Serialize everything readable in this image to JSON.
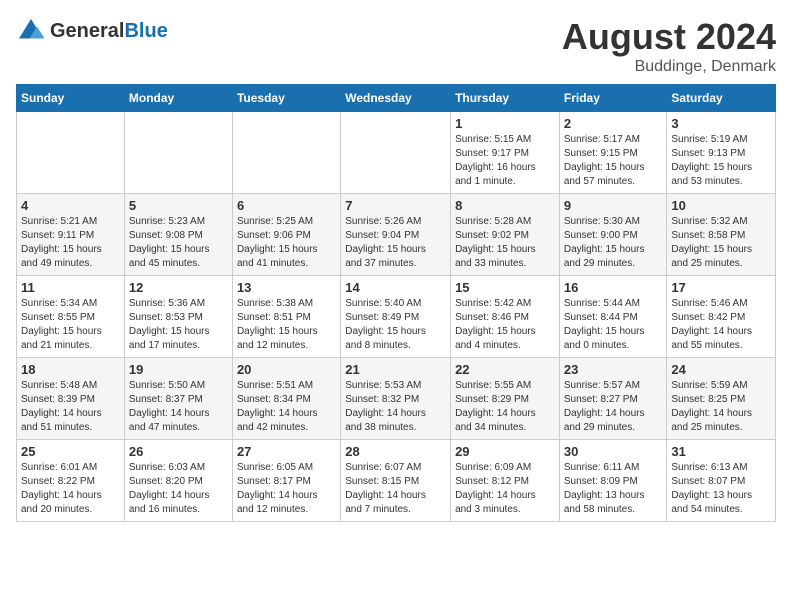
{
  "header": {
    "logo_general": "General",
    "logo_blue": "Blue",
    "title": "August 2024",
    "subtitle": "Buddinge, Denmark"
  },
  "calendar": {
    "days_of_week": [
      "Sunday",
      "Monday",
      "Tuesday",
      "Wednesday",
      "Thursday",
      "Friday",
      "Saturday"
    ],
    "weeks": [
      [
        {
          "day": "",
          "info": ""
        },
        {
          "day": "",
          "info": ""
        },
        {
          "day": "",
          "info": ""
        },
        {
          "day": "",
          "info": ""
        },
        {
          "day": "1",
          "info": "Sunrise: 5:15 AM\nSunset: 9:17 PM\nDaylight: 16 hours\nand 1 minute."
        },
        {
          "day": "2",
          "info": "Sunrise: 5:17 AM\nSunset: 9:15 PM\nDaylight: 15 hours\nand 57 minutes."
        },
        {
          "day": "3",
          "info": "Sunrise: 5:19 AM\nSunset: 9:13 PM\nDaylight: 15 hours\nand 53 minutes."
        }
      ],
      [
        {
          "day": "4",
          "info": "Sunrise: 5:21 AM\nSunset: 9:11 PM\nDaylight: 15 hours\nand 49 minutes."
        },
        {
          "day": "5",
          "info": "Sunrise: 5:23 AM\nSunset: 9:08 PM\nDaylight: 15 hours\nand 45 minutes."
        },
        {
          "day": "6",
          "info": "Sunrise: 5:25 AM\nSunset: 9:06 PM\nDaylight: 15 hours\nand 41 minutes."
        },
        {
          "day": "7",
          "info": "Sunrise: 5:26 AM\nSunset: 9:04 PM\nDaylight: 15 hours\nand 37 minutes."
        },
        {
          "day": "8",
          "info": "Sunrise: 5:28 AM\nSunset: 9:02 PM\nDaylight: 15 hours\nand 33 minutes."
        },
        {
          "day": "9",
          "info": "Sunrise: 5:30 AM\nSunset: 9:00 PM\nDaylight: 15 hours\nand 29 minutes."
        },
        {
          "day": "10",
          "info": "Sunrise: 5:32 AM\nSunset: 8:58 PM\nDaylight: 15 hours\nand 25 minutes."
        }
      ],
      [
        {
          "day": "11",
          "info": "Sunrise: 5:34 AM\nSunset: 8:55 PM\nDaylight: 15 hours\nand 21 minutes."
        },
        {
          "day": "12",
          "info": "Sunrise: 5:36 AM\nSunset: 8:53 PM\nDaylight: 15 hours\nand 17 minutes."
        },
        {
          "day": "13",
          "info": "Sunrise: 5:38 AM\nSunset: 8:51 PM\nDaylight: 15 hours\nand 12 minutes."
        },
        {
          "day": "14",
          "info": "Sunrise: 5:40 AM\nSunset: 8:49 PM\nDaylight: 15 hours\nand 8 minutes."
        },
        {
          "day": "15",
          "info": "Sunrise: 5:42 AM\nSunset: 8:46 PM\nDaylight: 15 hours\nand 4 minutes."
        },
        {
          "day": "16",
          "info": "Sunrise: 5:44 AM\nSunset: 8:44 PM\nDaylight: 15 hours\nand 0 minutes."
        },
        {
          "day": "17",
          "info": "Sunrise: 5:46 AM\nSunset: 8:42 PM\nDaylight: 14 hours\nand 55 minutes."
        }
      ],
      [
        {
          "day": "18",
          "info": "Sunrise: 5:48 AM\nSunset: 8:39 PM\nDaylight: 14 hours\nand 51 minutes."
        },
        {
          "day": "19",
          "info": "Sunrise: 5:50 AM\nSunset: 8:37 PM\nDaylight: 14 hours\nand 47 minutes."
        },
        {
          "day": "20",
          "info": "Sunrise: 5:51 AM\nSunset: 8:34 PM\nDaylight: 14 hours\nand 42 minutes."
        },
        {
          "day": "21",
          "info": "Sunrise: 5:53 AM\nSunset: 8:32 PM\nDaylight: 14 hours\nand 38 minutes."
        },
        {
          "day": "22",
          "info": "Sunrise: 5:55 AM\nSunset: 8:29 PM\nDaylight: 14 hours\nand 34 minutes."
        },
        {
          "day": "23",
          "info": "Sunrise: 5:57 AM\nSunset: 8:27 PM\nDaylight: 14 hours\nand 29 minutes."
        },
        {
          "day": "24",
          "info": "Sunrise: 5:59 AM\nSunset: 8:25 PM\nDaylight: 14 hours\nand 25 minutes."
        }
      ],
      [
        {
          "day": "25",
          "info": "Sunrise: 6:01 AM\nSunset: 8:22 PM\nDaylight: 14 hours\nand 20 minutes."
        },
        {
          "day": "26",
          "info": "Sunrise: 6:03 AM\nSunset: 8:20 PM\nDaylight: 14 hours\nand 16 minutes."
        },
        {
          "day": "27",
          "info": "Sunrise: 6:05 AM\nSunset: 8:17 PM\nDaylight: 14 hours\nand 12 minutes."
        },
        {
          "day": "28",
          "info": "Sunrise: 6:07 AM\nSunset: 8:15 PM\nDaylight: 14 hours\nand 7 minutes."
        },
        {
          "day": "29",
          "info": "Sunrise: 6:09 AM\nSunset: 8:12 PM\nDaylight: 14 hours\nand 3 minutes."
        },
        {
          "day": "30",
          "info": "Sunrise: 6:11 AM\nSunset: 8:09 PM\nDaylight: 13 hours\nand 58 minutes."
        },
        {
          "day": "31",
          "info": "Sunrise: 6:13 AM\nSunset: 8:07 PM\nDaylight: 13 hours\nand 54 minutes."
        }
      ]
    ]
  }
}
